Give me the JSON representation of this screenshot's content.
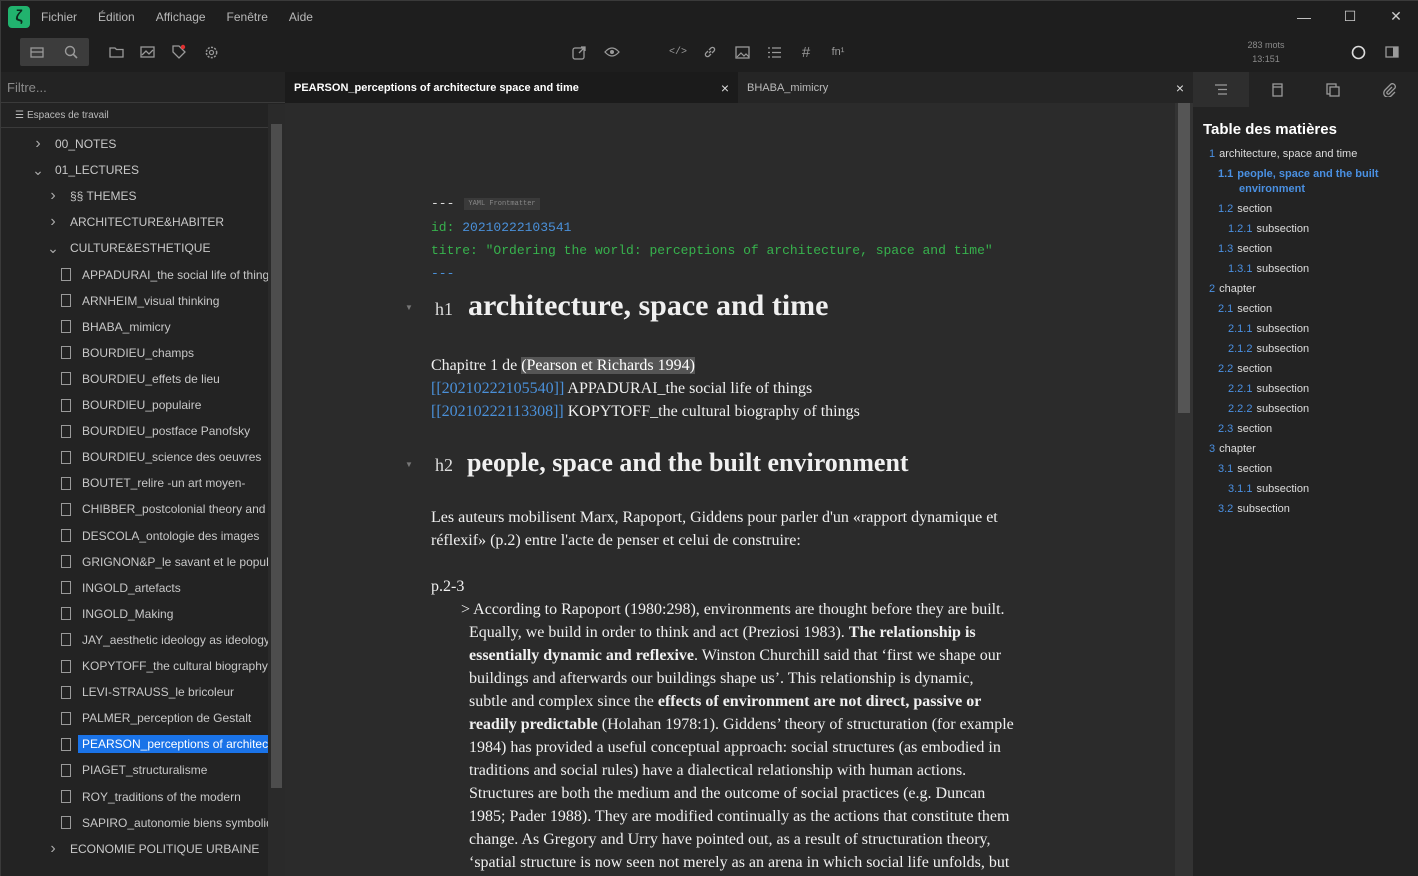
{
  "menu": [
    "Fichier",
    "Édition",
    "Affichage",
    "Fenêtre",
    "Aide"
  ],
  "window_controls": {
    "minimize": "—",
    "maximize": "☐",
    "close": "✕"
  },
  "stats": {
    "words": "283 mots",
    "time": "13:151"
  },
  "sidebar": {
    "filter_placeholder": "Filtre...",
    "workspaces_label": "Espaces de travail",
    "tree": [
      {
        "label": "00_NOTES",
        "type": "dir",
        "level": 1,
        "open": false
      },
      {
        "label": "01_LECTURES",
        "type": "dir",
        "level": 1,
        "open": true
      },
      {
        "label": "§§ THEMES",
        "type": "dir",
        "level": 2,
        "open": false
      },
      {
        "label": "ARCHITECTURE&HABITER",
        "type": "dir",
        "level": 2,
        "open": false
      },
      {
        "label": "CULTURE&ESTHETIQUE",
        "type": "dir",
        "level": 2,
        "open": true
      },
      {
        "label": "APPADURAI_the social life of things",
        "type": "file",
        "level": 3
      },
      {
        "label": "ARNHEIM_visual thinking",
        "type": "file",
        "level": 3
      },
      {
        "label": "BHABA_mimicry",
        "type": "file",
        "level": 3
      },
      {
        "label": "BOURDIEU_champs",
        "type": "file",
        "level": 3
      },
      {
        "label": "BOURDIEU_effets de lieu",
        "type": "file",
        "level": 3
      },
      {
        "label": "BOURDIEU_populaire",
        "type": "file",
        "level": 3
      },
      {
        "label": "BOURDIEU_postface Panofsky",
        "type": "file",
        "level": 3
      },
      {
        "label": "BOURDIEU_science des oeuvres",
        "type": "file",
        "level": 3
      },
      {
        "label": "BOUTET_relire -un art moyen-",
        "type": "file",
        "level": 3
      },
      {
        "label": "CHIBBER_postcolonial theory and",
        "type": "file",
        "level": 3
      },
      {
        "label": "DESCOLA_ontologie des images",
        "type": "file",
        "level": 3
      },
      {
        "label": "GRIGNON&P_le savant et le populaire",
        "type": "file",
        "level": 3
      },
      {
        "label": "INGOLD_artefacts",
        "type": "file",
        "level": 3
      },
      {
        "label": "INGOLD_Making",
        "type": "file",
        "level": 3
      },
      {
        "label": "JAY_aesthetic ideology as ideology",
        "type": "file",
        "level": 3
      },
      {
        "label": "KOPYTOFF_the cultural biography",
        "type": "file",
        "level": 3
      },
      {
        "label": "LEVI-STRAUSS_le bricoleur",
        "type": "file",
        "level": 3
      },
      {
        "label": "PALMER_perception de Gestalt",
        "type": "file",
        "level": 3
      },
      {
        "label": "PEARSON_perceptions of architecture",
        "type": "file",
        "level": 3,
        "selected": true
      },
      {
        "label": "PIAGET_structuralisme",
        "type": "file",
        "level": 3
      },
      {
        "label": "ROY_traditions of the modern",
        "type": "file",
        "level": 3
      },
      {
        "label": "SAPIRO_autonomie biens symboliques",
        "type": "file",
        "level": 3
      },
      {
        "label": "ECONOMIE POLITIQUE URBAINE",
        "type": "dir",
        "level": 2,
        "open": false
      }
    ]
  },
  "tabs": [
    {
      "label": "PEARSON_perceptions of architecture space and time",
      "active": true,
      "close": "×"
    },
    {
      "label": "BHABA_mimicry",
      "active": false,
      "close": "×"
    }
  ],
  "editor": {
    "yaml_dashes": "---",
    "yaml_badge": "YAML Frontmatter",
    "id_key": "id:",
    "id_val": "20210222103541",
    "titre_key": "titre:",
    "titre_val": "\"Ordering the world: perceptions of architecture, space and time\"",
    "yaml_end": "---",
    "h1_marker": "h1",
    "h1": "architecture, space and time",
    "p1_text": "Chapitre 1 de ",
    "p1_cite": "(Pearson et Richards 1994)",
    "link1_id": "[[20210222105540]]",
    "link1_text": " APPADURAI_the social life of things",
    "link2_id": "[[20210222113308]]",
    "link2_text": " KOPYTOFF_the cultural biography of things",
    "h2_marker": "h2",
    "h2": "people, space and the built environment",
    "p2_l1": "Les auteurs mobilisent Marx, Rapoport, Giddens pour parler d'un «rapport dynamique et",
    "p2_l2": "réflexif» (p.2) entre l'acte de penser et celui de construire:",
    "p3": "p.2-3",
    "quote": [
      "> According to Rapoport (1980:298), environments are thought before they are built.",
      "Equally, we build in order to think and act (Preziosi 1983). |The relationship is",
      "|essentially dynamic and reflexive|. Winston Churchill said that ‘first we shape our",
      "buildings and afterwards our buildings shape us’. This relationship is dynamic,",
      "subtle and complex since the |effects of environment are not direct, passive or",
      "|readily predictable| (Holahan 1978:1). Giddens’ theory of structuration (for example",
      "1984) has provided a useful conceptual approach: social structures (as embodied in",
      "traditions and social rules) have a dialectical relationship with human actions.",
      "Structures are both the medium and the outcome of social practices (e.g. Duncan",
      "1985; Pader 1988). They are modified continually as the actions that constitute them",
      "change. As Gregory and Urry have pointed out, as a result of structuration theory,",
      "‘spatial structure is now seen not merely as an arena in which social life unfolds, but"
    ]
  },
  "toc": {
    "title": "Table des matières",
    "items": [
      {
        "num": "1",
        "label": "architecture, space and time",
        "level": 0
      },
      {
        "num": "1.1",
        "label": "people, space and the built",
        "label2": "environment",
        "level": 1,
        "current": true
      },
      {
        "num": "1.2",
        "label": "section",
        "level": 1
      },
      {
        "num": "1.2.1",
        "label": "subsection",
        "level": 2
      },
      {
        "num": "1.3",
        "label": "section",
        "level": 1
      },
      {
        "num": "1.3.1",
        "label": "subsection",
        "level": 2
      },
      {
        "num": "2",
        "label": "chapter",
        "level": 0
      },
      {
        "num": "2.1",
        "label": "section",
        "level": 1
      },
      {
        "num": "2.1.1",
        "label": "subsection",
        "level": 2
      },
      {
        "num": "2.1.2",
        "label": "subsection",
        "level": 2
      },
      {
        "num": "2.2",
        "label": "section",
        "level": 1
      },
      {
        "num": "2.2.1",
        "label": "subsection",
        "level": 2
      },
      {
        "num": "2.2.2",
        "label": "subsection",
        "level": 2
      },
      {
        "num": "2.3",
        "label": "section",
        "level": 1
      },
      {
        "num": "3",
        "label": "chapter",
        "level": 0
      },
      {
        "num": "3.1",
        "label": "section",
        "level": 1
      },
      {
        "num": "3.1.1",
        "label": "subsection",
        "level": 2
      },
      {
        "num": "3.2",
        "label": "subsection",
        "level": 1
      }
    ]
  },
  "colors": {
    "accent": "#1a73e8",
    "link": "#4a90d9",
    "yaml_green": "#37b24d",
    "logo": "#21b36e"
  }
}
